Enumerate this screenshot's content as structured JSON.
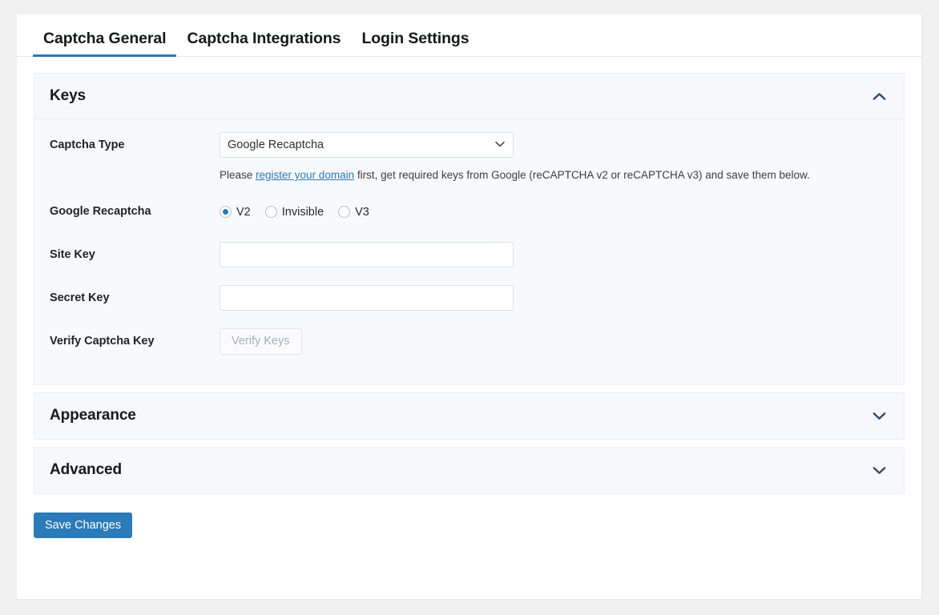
{
  "tabs": [
    {
      "label": "Captcha General",
      "active": true
    },
    {
      "label": "Captcha Integrations",
      "active": false
    },
    {
      "label": "Login Settings",
      "active": false
    }
  ],
  "panels": {
    "keys": {
      "title": "Keys",
      "chevron": "chevron-up-icon",
      "rows": {
        "captcha_type": {
          "label": "Captcha Type",
          "value": "Google Recaptcha",
          "options": [
            "Google Recaptcha"
          ],
          "chevron": "chevron-down-icon",
          "help_prefix": "Please ",
          "help_link": "register your domain",
          "help_suffix": " first, get required keys from Google (reCAPTCHA v2 or reCAPTCHA v3) and save them below."
        },
        "google_recaptcha": {
          "label": "Google Recaptcha",
          "options": [
            {
              "label": "V2",
              "checked": true
            },
            {
              "label": "Invisible",
              "checked": false
            },
            {
              "label": "V3",
              "checked": false
            }
          ]
        },
        "site_key": {
          "label": "Site Key",
          "value": "",
          "placeholder": ""
        },
        "secret_key": {
          "label": "Secret Key",
          "value": "",
          "placeholder": ""
        },
        "verify": {
          "label": "Verify Captcha Key",
          "button_label": "Verify Keys"
        }
      }
    },
    "appearance": {
      "title": "Appearance",
      "chevron": "chevron-down-icon"
    },
    "advanced": {
      "title": "Advanced",
      "chevron": "chevron-down-icon"
    }
  },
  "footer": {
    "save_label": "Save Changes"
  },
  "colors": {
    "accent": "#2b7bb9",
    "page_background": "#f0f0f1",
    "panel_background": "#f7f8fb",
    "text": "#17191c"
  }
}
